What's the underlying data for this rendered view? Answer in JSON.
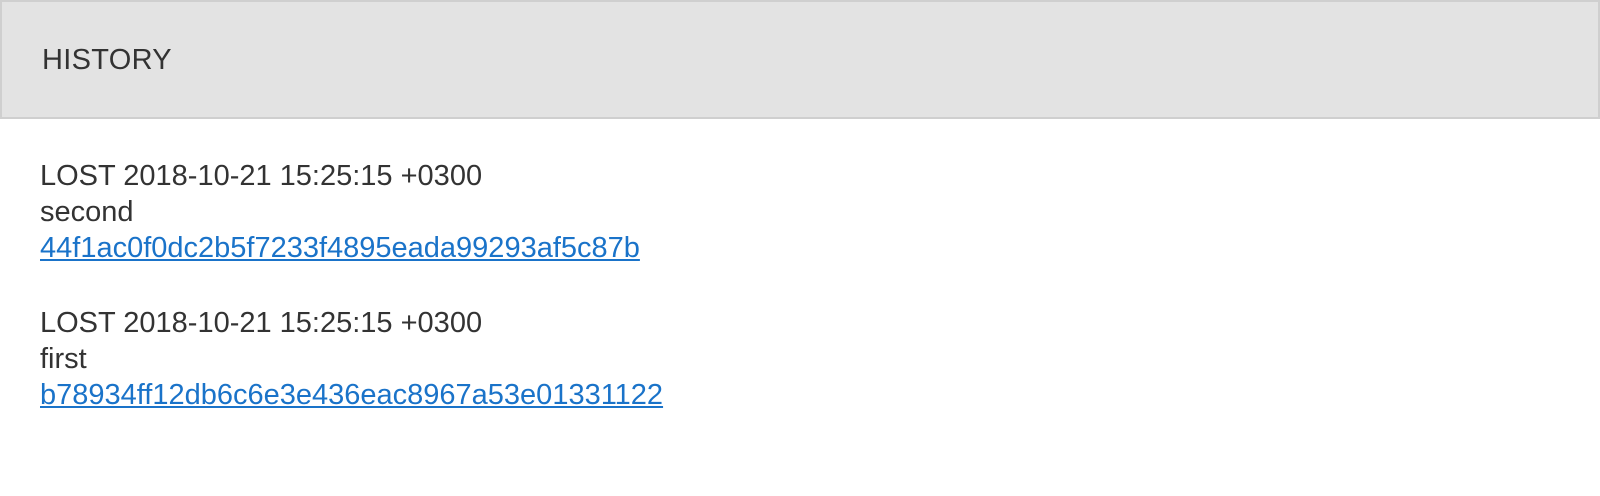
{
  "header": {
    "title": "HISTORY"
  },
  "entries": [
    {
      "status": "LOST",
      "timestamp": "2018-10-21 15:25:15 +0300",
      "message": "second",
      "hash": "44f1ac0f0dc2b5f7233f4895eada99293af5c87b"
    },
    {
      "status": "LOST",
      "timestamp": "2018-10-21 15:25:15 +0300",
      "message": "first",
      "hash": "b78934ff12db6c6e3e436eac8967a53e01331122"
    }
  ],
  "colors": {
    "header_background": "#e3e3e3",
    "header_border": "#cfcfcf",
    "text": "#333333",
    "link": "#1a73c9"
  }
}
